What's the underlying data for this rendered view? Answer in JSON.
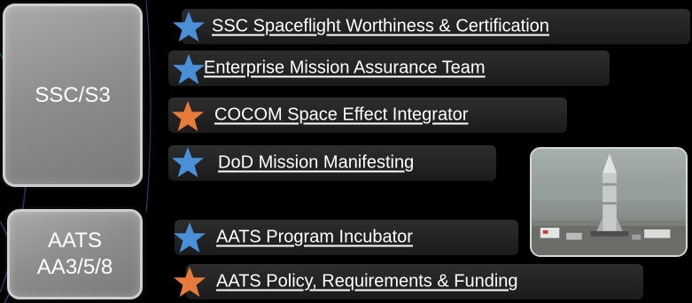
{
  "org_boxes": {
    "ssc": {
      "line1": "SSC/S3"
    },
    "aats": {
      "line1": "AATS",
      "line2": "AA3/5/8"
    }
  },
  "items": [
    {
      "label": "SSC Spaceflight Worthiness & Certification",
      "star_color": "#4a90d9"
    },
    {
      "label": "Enterprise Mission Assurance Team",
      "star_color": "#4a90d9"
    },
    {
      "label": "COCOM Space Effect Integrator",
      "star_color": "#e77b3a"
    },
    {
      "label": "DoD Mission Manifesting",
      "star_color": "#4a90d9"
    },
    {
      "label": "AATS Program Incubator",
      "star_color": "#4a90d9"
    },
    {
      "label": "AATS Policy, Requirements & Funding",
      "star_color": "#e77b3a"
    }
  ],
  "colors": {
    "blue_star": "#4a90d9",
    "orange_star": "#e77b3a"
  }
}
